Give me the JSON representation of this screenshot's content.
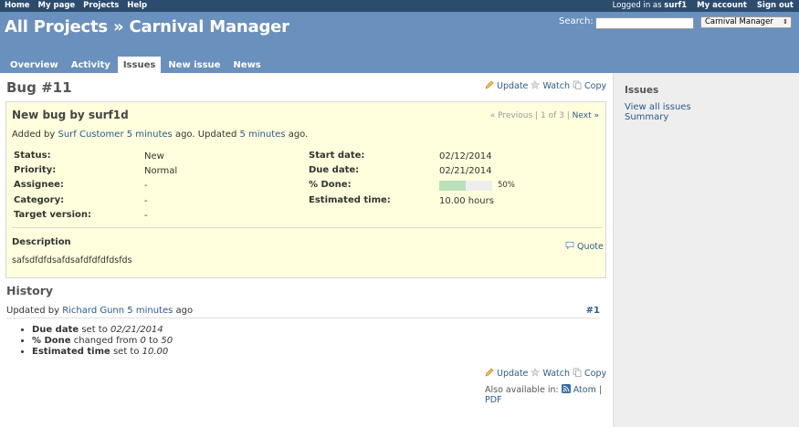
{
  "top_menu": {
    "left": [
      "Home",
      "My page",
      "Projects",
      "Help"
    ],
    "logged_in_prefix": "Logged in as ",
    "user": "surf1",
    "my_account": "My account",
    "sign_out": "Sign out"
  },
  "header": {
    "title": "All Projects » Carnival Manager",
    "search_label": "Search:",
    "search_value": "",
    "project_select": "Carnival Manager"
  },
  "tabs": [
    {
      "label": "Overview",
      "selected": false
    },
    {
      "label": "Activity",
      "selected": false
    },
    {
      "label": "Issues",
      "selected": true
    },
    {
      "label": "New issue",
      "selected": false
    },
    {
      "label": "News",
      "selected": false
    }
  ],
  "issue": {
    "title": "Bug #11",
    "actions": {
      "update": "Update",
      "watch": "Watch",
      "copy": "Copy"
    },
    "subject": "New bug by surf1d",
    "prev": "« Previous",
    "sep1": "|",
    "position": "1 of 3",
    "sep2": "|",
    "next": "Next »",
    "added_by": "Added by ",
    "author": "Surf Customer",
    "created_ago": "5 minutes",
    "ago_updated": " ago. Updated ",
    "updated_ago": "5 minutes",
    "ago_end": " ago.",
    "attributes_left": [
      {
        "label": "Status:",
        "value": "New"
      },
      {
        "label": "Priority:",
        "value": "Normal"
      },
      {
        "label": "Assignee:",
        "value": "-"
      },
      {
        "label": "Category:",
        "value": "-"
      },
      {
        "label": "Target version:",
        "value": "-"
      }
    ],
    "attributes_right": [
      {
        "label": "Start date:",
        "value": "02/12/2014"
      },
      {
        "label": "Due date:",
        "value": "02/21/2014"
      },
      {
        "label": "% Done:",
        "value": "50%"
      },
      {
        "label": "Estimated time:",
        "value": "10.00 hours"
      }
    ],
    "done_ratio": 0.5,
    "description_label": "Description",
    "quote": "Quote",
    "description": "safsdfdfdsafdsafdfdfdfdsfds"
  },
  "history": {
    "heading": "History",
    "updated_by": "Updated by ",
    "user": "Richard Gunn",
    "ago": "5 minutes",
    "ago_suffix": " ago",
    "number": "#1",
    "details": [
      {
        "field": "Due date",
        "text": " set to ",
        "value": "02/21/2014"
      },
      {
        "field": "% Done",
        "text": " changed from ",
        "from": "0",
        "to_text": " to ",
        "value": "50"
      },
      {
        "field": "Estimated time",
        "text": " set to ",
        "value": "10.00"
      }
    ]
  },
  "also_available": {
    "label": "Also available in:",
    "atom": "Atom",
    "sep": "|",
    "pdf": "PDF"
  },
  "sidebar": {
    "heading": "Issues",
    "links": [
      "View all issues",
      "Summary"
    ]
  },
  "colors": {
    "header": "#6a90bd",
    "top_menu": "#2c4c6e",
    "issue_box": "#ffffdd",
    "link": "#2a5a8a",
    "progress_done": "#bae0ba"
  }
}
